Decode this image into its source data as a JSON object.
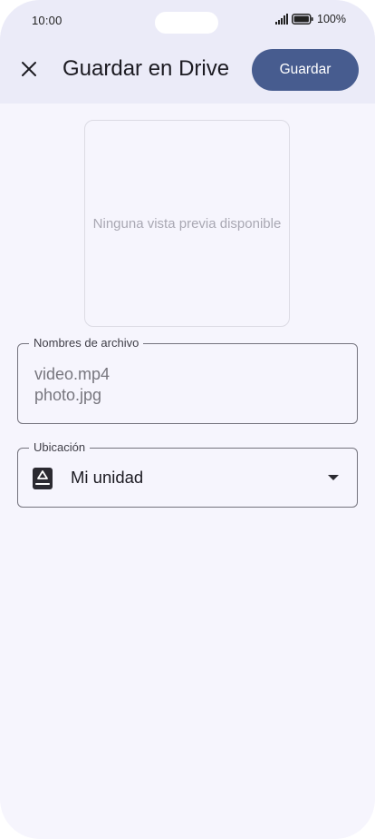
{
  "status_bar": {
    "time": "10:00",
    "battery": "100%"
  },
  "app_bar": {
    "title": "Guardar en Drive",
    "save_label": "Guardar"
  },
  "preview": {
    "empty_text": "Ninguna vista previa disponible"
  },
  "filenames_field": {
    "label": "Nombres de archivo",
    "files": [
      "video.mp4",
      "photo.jpg"
    ]
  },
  "location_field": {
    "label": "Ubicación",
    "value": "Mi unidad",
    "icon": "drive-storage-icon"
  },
  "colors": {
    "accent": "#475c8f",
    "top_bar": "#ebebf8",
    "background": "#f6f5fd"
  }
}
